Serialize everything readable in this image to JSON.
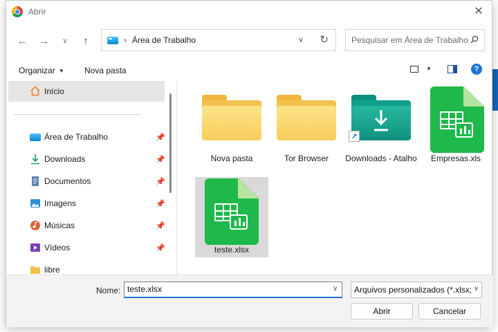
{
  "window": {
    "title": "Abrir"
  },
  "address": {
    "location": "Área de Trabalho",
    "separator": "›"
  },
  "search": {
    "placeholder": "Pesquisar em Área de Trabalho"
  },
  "toolbar": {
    "organize_label": "Organizar",
    "new_folder_label": "Nova pasta"
  },
  "sidebar": {
    "home_label": "Início",
    "items": [
      {
        "label": "Área de Trabalho",
        "icon": "desktop-icon",
        "pinned": true
      },
      {
        "label": "Downloads",
        "icon": "download-icon",
        "pinned": true
      },
      {
        "label": "Documentos",
        "icon": "document-icon",
        "pinned": true
      },
      {
        "label": "Imagens",
        "icon": "image-icon",
        "pinned": true
      },
      {
        "label": "Músicas",
        "icon": "music-icon",
        "pinned": true
      },
      {
        "label": "Vídeos",
        "icon": "video-icon",
        "pinned": true
      },
      {
        "label": "libre",
        "icon": "folder-icon",
        "pinned": false
      }
    ]
  },
  "files": [
    {
      "name": "Nova pasta",
      "type": "folder"
    },
    {
      "name": "Tor Browser",
      "type": "folder"
    },
    {
      "name": "Downloads - Atalho",
      "type": "shortcut-folder"
    },
    {
      "name": "Empresas.xls",
      "type": "spreadsheet"
    },
    {
      "name": "teste.xlsx",
      "type": "spreadsheet",
      "selected": true
    }
  ],
  "footer": {
    "name_label": "Nome:",
    "name_value": "teste.xlsx",
    "file_type": "Arquivos personalizados (*.xlsx;",
    "open_label": "Abrir",
    "cancel_label": "Cancelar"
  },
  "colors": {
    "accent": "#1e74d8",
    "spreadsheet_green": "#1fb84a",
    "folder_yellow": "#f7cd5a",
    "download_teal": "#12a08d"
  }
}
